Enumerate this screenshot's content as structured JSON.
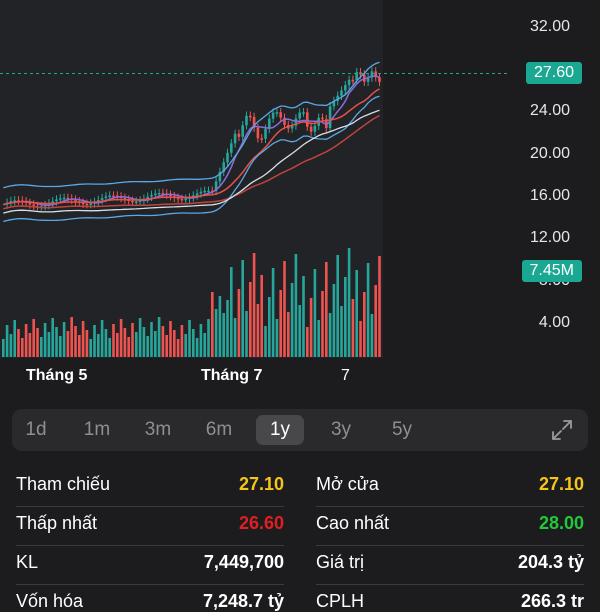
{
  "chart": {
    "y_axis_labels": [
      "32.00",
      "24.00",
      "20.00",
      "16.00",
      "12.00",
      "4.00"
    ],
    "hidden_label": "8.00",
    "x_axis_labels": [
      "Tháng 5",
      "Tháng 7",
      "7"
    ],
    "current_price_tag": "27.60",
    "volume_tag": "7.45M",
    "colors": {
      "up": "#26a69a",
      "down": "#ef5350",
      "ma_short": "#8e6cd8",
      "ma_mid": "#e8504a",
      "ma_long": "#c0443c",
      "bollinger": "#5aa9e6",
      "trend": "#d8dde6",
      "tag_bg": "#1aa893"
    }
  },
  "chart_data": {
    "type": "candlestick",
    "price_axis": {
      "min": 4,
      "max": 32
    },
    "current_price": 27.6,
    "current_volume": "7.45M"
  },
  "range_selector": {
    "options": [
      "1d",
      "1m",
      "3m",
      "6m",
      "1y",
      "3y",
      "5y"
    ],
    "selected": "1y"
  },
  "stats": [
    {
      "left_label": "Tham chiếu",
      "left_value": "27.10",
      "left_color": "#f5c518",
      "right_label": "Mở cửa",
      "right_value": "27.10",
      "right_color": "#f5c518"
    },
    {
      "left_label": "Thấp nhất",
      "left_value": "26.60",
      "left_color": "#e02020",
      "right_label": "Cao nhất",
      "right_value": "28.00",
      "right_color": "#22c83a"
    },
    {
      "left_label": "KL",
      "left_value": "7,449,700",
      "left_color": "#ffffff",
      "right_label": "Giá trị",
      "right_value": "204.3 tỷ",
      "right_color": "#ffffff"
    },
    {
      "left_label": "Vốn hóa",
      "left_value": "7,248.7 tỷ",
      "left_color": "#ffffff",
      "right_label": "CPLH",
      "right_value": "266.3 tr",
      "right_color": "#ffffff"
    }
  ]
}
